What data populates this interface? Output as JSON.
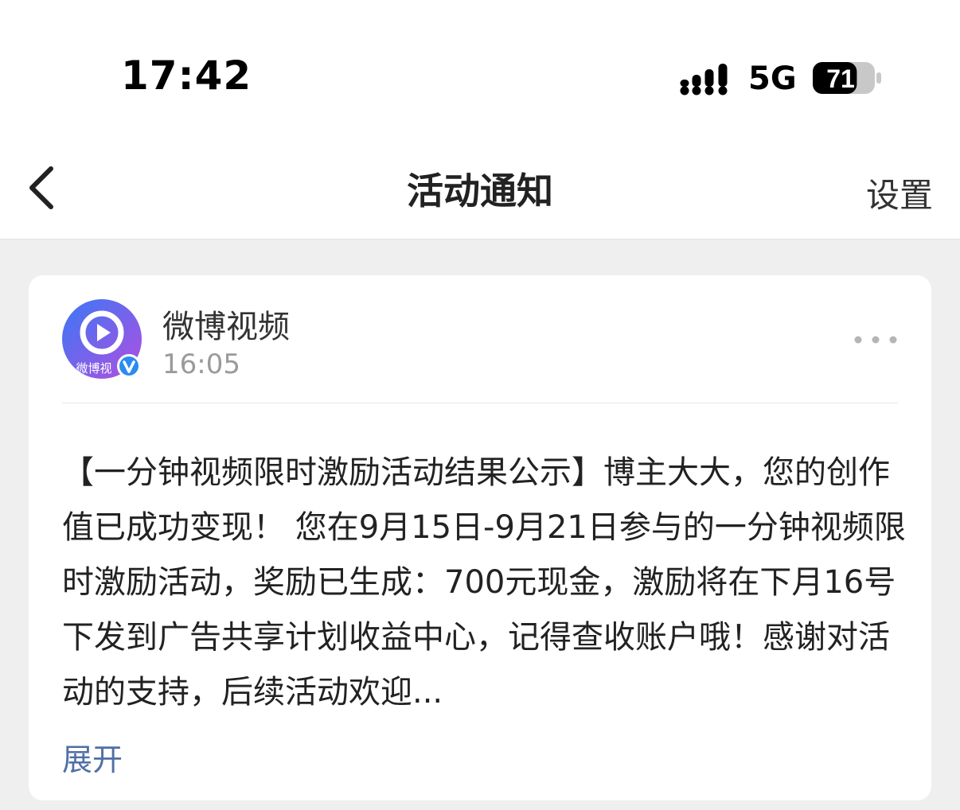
{
  "status_bar": {
    "time": "17:42",
    "network": "5G",
    "battery": "71",
    "battery_level": 0.71
  },
  "nav": {
    "title": "活动通知",
    "settings_label": "设置",
    "back_icon": "chevron-left-icon"
  },
  "message": {
    "avatar_text": "微博视",
    "sender": "微博视频",
    "time": "16:05",
    "more_icon": "more-horizontal-icon",
    "verified_icon": "verified-badge-icon",
    "body": "【一分钟视频限时激励活动结果公示】博主大大，您的创作值已成功变现！ 您在9月15日-9月21日参与的一分钟视频限时激励活动，奖励已生成：700元现金，激励将在下月16号下发到广告共享计划收益中心，记得查收账户哦！感谢对活动的支持，后续活动欢迎...",
    "expand_label": "展开"
  },
  "colors": {
    "background": "#efefef",
    "card": "#ffffff",
    "link": "#4f6fa6",
    "verified": "#2b8cf0"
  }
}
